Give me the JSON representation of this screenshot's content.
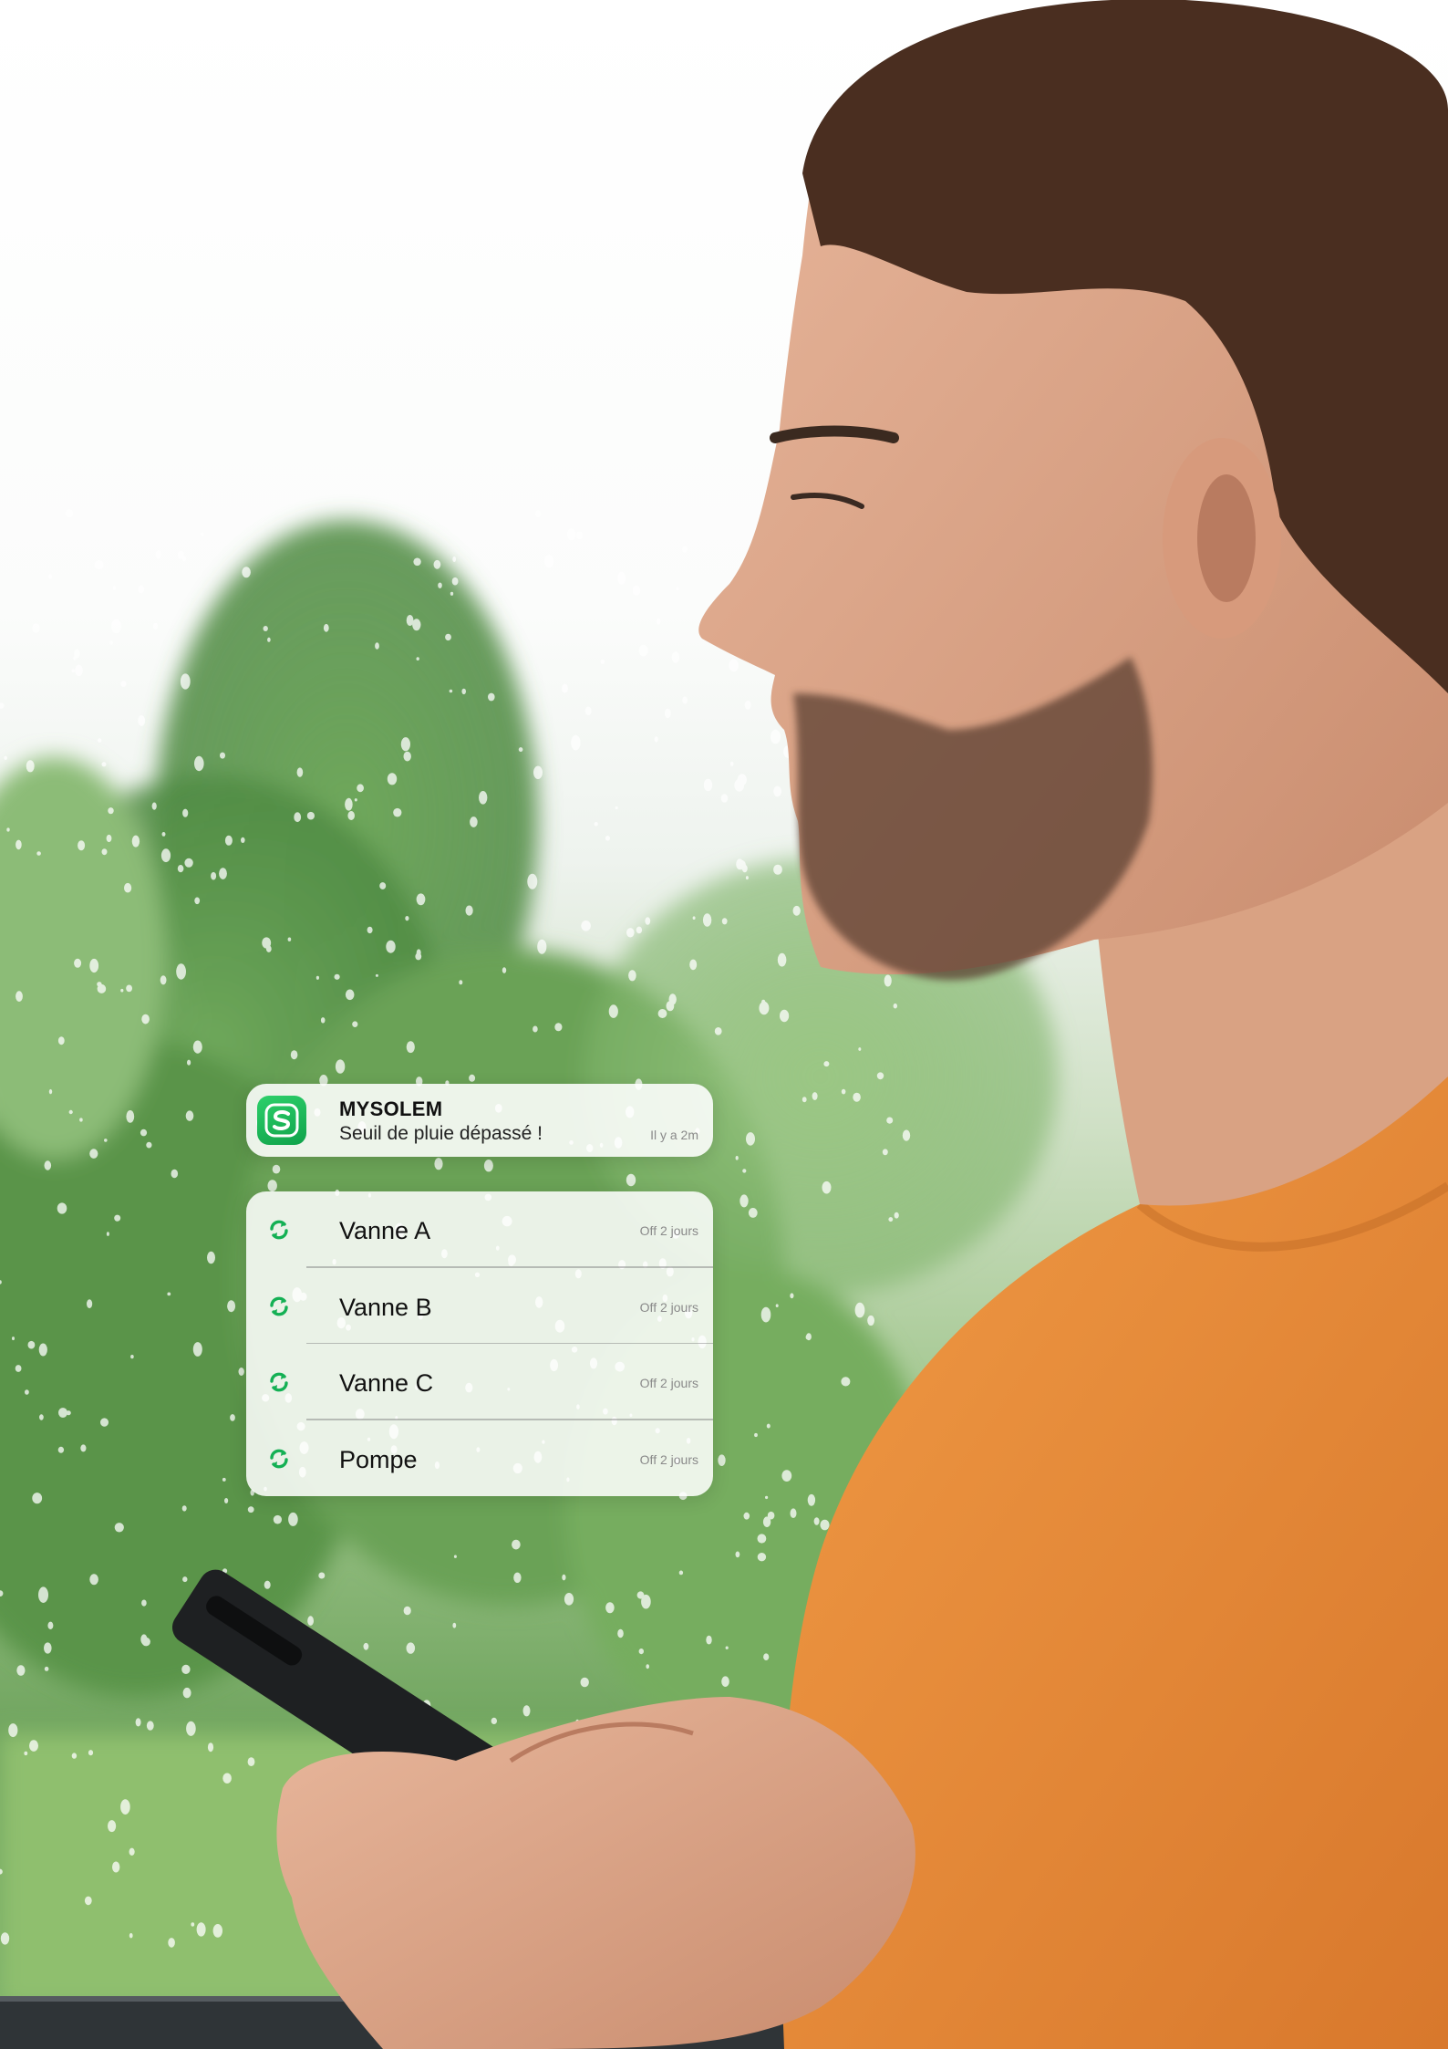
{
  "colors": {
    "accent_green": "#14b054",
    "shirt_orange": "#e3893a"
  },
  "notification": {
    "app_name": "MYSOLEM",
    "message": "Seuil de pluie dépassé !",
    "time": "Il y a 2m",
    "icon": "mysolem-app-icon"
  },
  "devices": [
    {
      "name": "Vanne A",
      "status": "Off 2 jours",
      "icon": "sync-icon"
    },
    {
      "name": "Vanne B",
      "status": "Off 2 jours",
      "icon": "sync-icon"
    },
    {
      "name": "Vanne C",
      "status": "Off 2 jours",
      "icon": "sync-icon"
    },
    {
      "name": "Pompe",
      "status": "Off 2 jours",
      "icon": "sync-icon"
    }
  ]
}
